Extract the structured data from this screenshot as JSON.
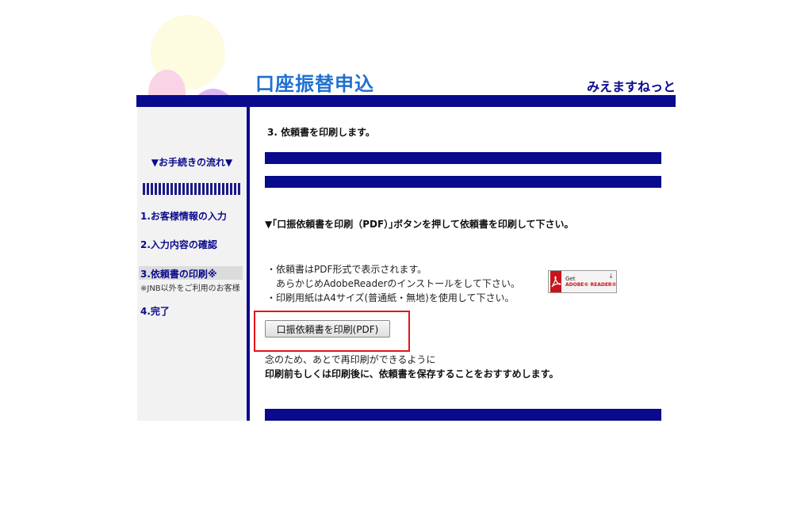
{
  "colors": {
    "navy": "#0a0a8c",
    "title_blue": "#1f6fd1",
    "circle_yellow": "#fdfbe0",
    "circle_pink": "#f9d4e6",
    "circle_purple": "#dab6f4",
    "highlight_red": "#e0141a"
  },
  "header": {
    "title": "口座振替申込",
    "site_name": "みえますねっと"
  },
  "sidebar": {
    "flow_label": "▼お手続きの流れ▼",
    "steps": [
      {
        "label": "1.お客様情報の入力"
      },
      {
        "label": "2.入力内容の確認"
      },
      {
        "label": "3.依頼書の印刷※",
        "note": "※JNB以外をご利用のお客様"
      },
      {
        "label": "4.完了"
      }
    ]
  },
  "main": {
    "heading": "3. 依頼書を印刷します。",
    "instruction": "▼｢口振依頼書を印刷（PDF）｣ボタンを押して依頼書を印刷して下さい。",
    "notes": [
      "・依頼書はPDF形式で表示されます。",
      "　あらかじめAdobeReaderのインストールをして下さい。",
      "・印刷用紙はA4サイズ(普通紙・無地)を使用して下さい。"
    ],
    "adobe_badge": {
      "get": "Get",
      "reader": "ADOBE® READER®",
      "icon": "adobe-reader-icon"
    },
    "print_button": "口振依頼書を印刷(PDF)",
    "footer_line1": "念のため、あとで再印刷ができるように",
    "footer_line2": "印刷前もしくは印刷後に、依頼書を保存することをおすすめします。"
  }
}
